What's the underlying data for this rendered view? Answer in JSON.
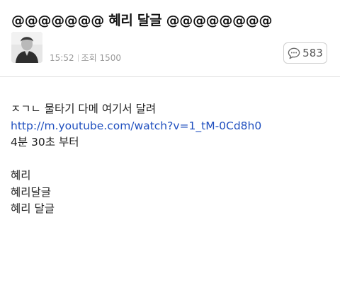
{
  "post": {
    "title": "@@@@@@@ 혜리 달글 @@@@@@@@",
    "time": "15:52",
    "views_label": "조회 1500",
    "comment_count": "583"
  },
  "body": {
    "line1": "ㅈㄱㄴ 물타기 다메 여기서 달려",
    "link": "http://m.youtube.com/watch?v=1_tM-0Cd8h0",
    "line3": "4분 30초 부터",
    "line5": "혜리",
    "line6": "혜리달글",
    "line7": "혜리 달글"
  }
}
